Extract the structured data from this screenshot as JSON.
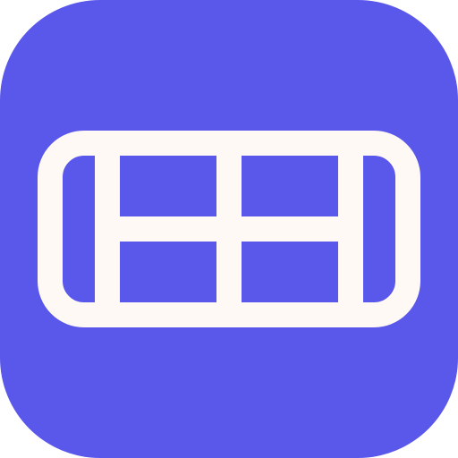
{
  "app_icon": {
    "icon_name": "grid-table-icon",
    "background_color": "#5A57EB",
    "glyph_color": "#FEF9F4"
  }
}
